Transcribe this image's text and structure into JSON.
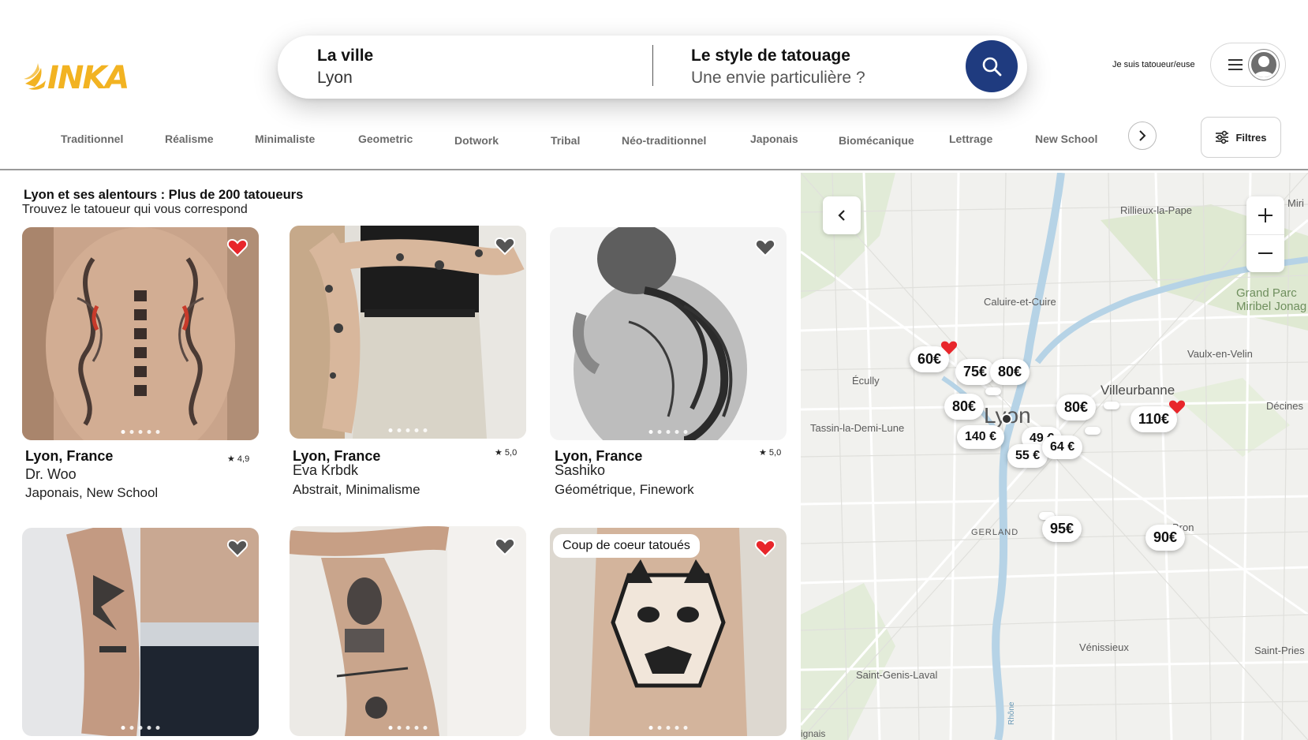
{
  "brand": {
    "name": "INKA",
    "color": "#f2b322"
  },
  "search": {
    "city_label": "La ville",
    "city_value": "Lyon",
    "style_label": "Le style de tatouage",
    "style_placeholder": "Une envie particulière ?",
    "button_icon": "search-icon",
    "button_color": "#1f3b7f"
  },
  "header": {
    "pro_link": "Je suis tatoueur/euse",
    "menu_icon": "hamburger-icon",
    "avatar_icon": "user-avatar-icon"
  },
  "categories": {
    "items": [
      "Traditionnel",
      "Réalisme",
      "Minimaliste",
      "Geometric",
      "Dotwork",
      "Tribal",
      "Néo-traditionnel",
      "Japonais",
      "Biomécanique",
      "Lettrage",
      "New School"
    ],
    "next_icon": "chevron-right-icon",
    "filters_label": "Filtres",
    "filters_icon": "sliders-icon"
  },
  "results": {
    "title": "Lyon et ses alentours : Plus de 200 tatoueurs",
    "subtitle": "Trouvez le tatoueur qui vous correspond",
    "cards": [
      {
        "location": "Lyon, France",
        "rating": "4,9",
        "name": "Dr. Woo",
        "styles": "Japonais, New School",
        "favorite": true
      },
      {
        "location": "Lyon, France",
        "rating": "5,0",
        "name": "Eva Krbdk",
        "styles": "Abstrait, Minimalisme",
        "favorite": false
      },
      {
        "location": "Lyon, France",
        "rating": "5,0",
        "name": "Sashiko",
        "styles": "Géométrique, Finework",
        "favorite": false
      },
      {
        "favorite": false
      },
      {
        "favorite": false
      },
      {
        "badge": "Coup de coeur tatoués",
        "favorite": true
      }
    ]
  },
  "map": {
    "labels": {
      "rillieux": "Rillieux-la-Pape",
      "miri": "Miri",
      "grand_parc_1": "Grand Parc",
      "grand_parc_2": "Miribel Jonag",
      "caluire": "Caluire-et-Cuire",
      "vaulx": "Vaulx-en-Velin",
      "ecully": "Écully",
      "villeurbanne": "Villeurbanne",
      "decines": "Décines",
      "tassin": "Tassin-la-Demi-Lune",
      "lyon": "Lyon",
      "gerland": "GERLAND",
      "bron": "Bron",
      "venissieux": "Vénissieux",
      "saint_priest": "Saint-Pries",
      "saint_genis": "Saint-Genis-Laval",
      "bottom_left": "ignais",
      "rhone": "Rhône"
    },
    "prices": {
      "p60": "60€",
      "p75": "75€",
      "p80a": "80€",
      "p80b": "80€",
      "p80c": "80€",
      "p110": "110€",
      "p140": "140 €",
      "p49": "49 €",
      "p55": "55 €",
      "p64": "64 €",
      "p95": "95€",
      "p90": "90€"
    },
    "favorite_pins": [
      "60€",
      "110€"
    ],
    "back_icon": "chevron-left-icon",
    "zoom_in_icon": "plus-icon",
    "zoom_out_icon": "minus-icon"
  },
  "colors": {
    "heart_red": "#e8262b",
    "category_text": "#6b6b6b"
  }
}
